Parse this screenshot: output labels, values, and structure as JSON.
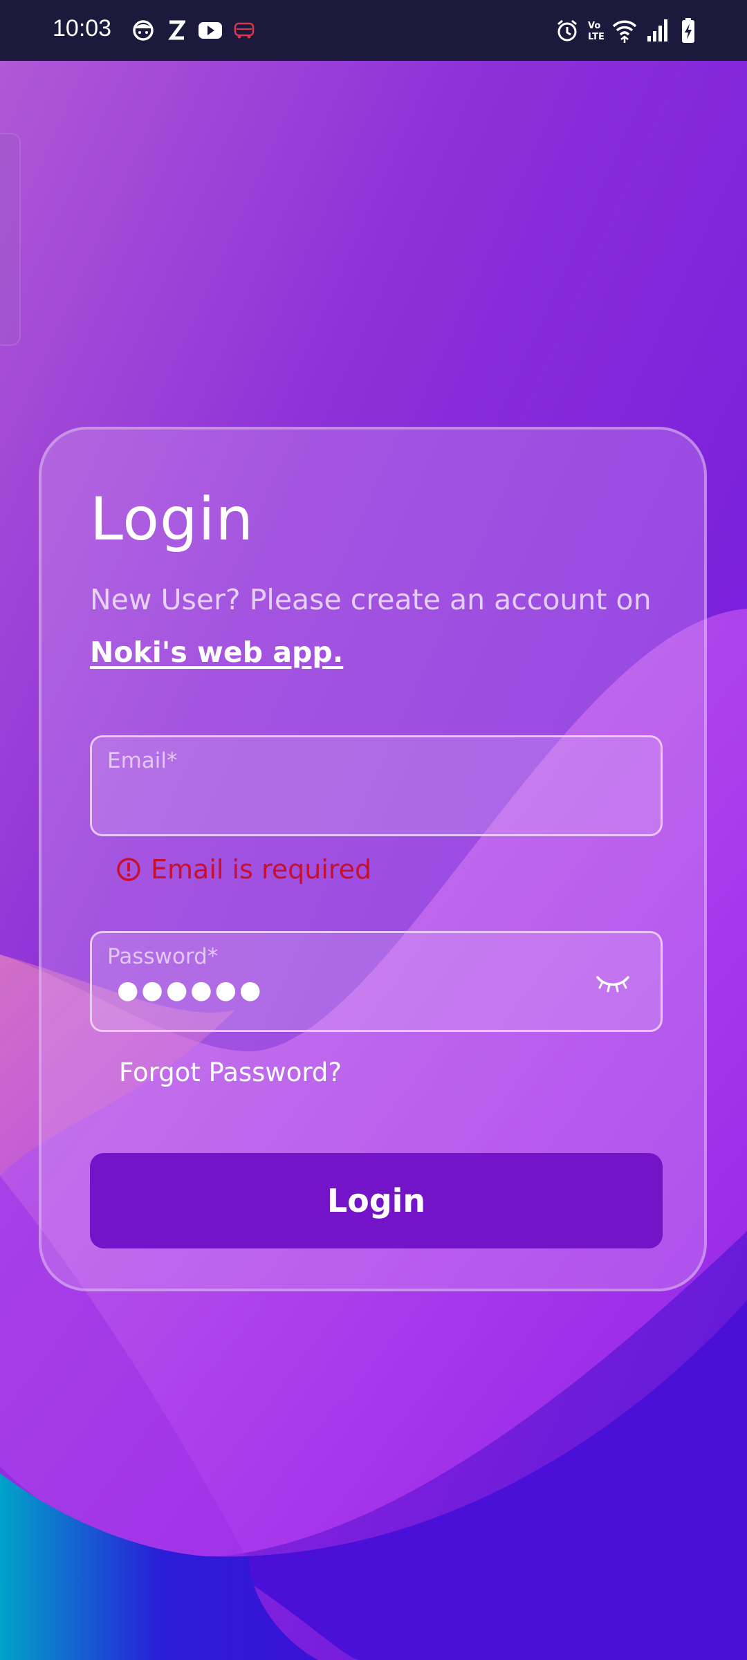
{
  "status_bar": {
    "time": "10:03",
    "left_icons": [
      "app-face-icon",
      "z-app-icon",
      "youtube-icon",
      "redbus-icon"
    ],
    "right_icons": [
      "alarm-icon",
      "volte-icon",
      "wifi-icon",
      "signal-icon",
      "battery-charging-icon"
    ],
    "volte_text": "Vo)) LTE"
  },
  "login_card": {
    "title": "Login",
    "subtitle": "New User? Please create an account on",
    "link_text": "Noki's web app.",
    "email": {
      "label": "Email*",
      "value": "",
      "error": "Email is required"
    },
    "password": {
      "label": "Password*",
      "value": "●●●●●●"
    },
    "forgot_password": "Forgot Password?",
    "login_button": "Login"
  },
  "colors": {
    "status_bar_bg": "#1b1a3d",
    "button_bg": "#7414c8",
    "error": "#c8102e",
    "background_purple": "#8a33db",
    "background_blue": "#4a12d8",
    "background_teal": "#00a3c9"
  }
}
